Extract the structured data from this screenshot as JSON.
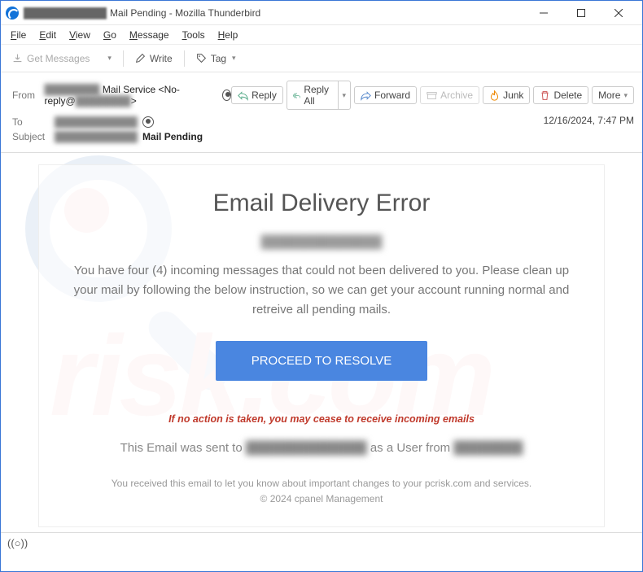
{
  "window": {
    "title_blurred": "████████████",
    "title_suffix": "Mail Pending - Mozilla Thunderbird"
  },
  "menu": {
    "file": "File",
    "edit": "Edit",
    "view": "View",
    "go": "Go",
    "message": "Message",
    "tools": "Tools",
    "help": "Help"
  },
  "toolbar": {
    "get_messages": "Get Messages",
    "write": "Write",
    "tag": "Tag"
  },
  "actions": {
    "reply": "Reply",
    "reply_all": "Reply All",
    "forward": "Forward",
    "archive": "Archive",
    "junk": "Junk",
    "delete": "Delete",
    "more": "More"
  },
  "headers": {
    "from_label": "From",
    "from_blur": "████████",
    "from_text": "Mail Service <No-reply@",
    "from_text2": "████████",
    "from_text3": ">",
    "to_label": "To",
    "to_blur": "████████████",
    "subject_label": "Subject",
    "subject_blur": "████████████",
    "subject_bold": "Mail Pending",
    "timestamp": "12/16/2024, 7:47 PM"
  },
  "email": {
    "heading": "Email Delivery Error",
    "recipient_blur": "██████████████",
    "paragraph": "You have four (4) incoming messages that could not been delivered to you. Please  clean up your mail  by following the below instruction, so we can get your account running normal and retreive all pending mails.",
    "cta": "PROCEED TO RESOLVE",
    "warning": "If no action is taken, you may cease to receive incoming emails",
    "sent_prefix": "This Email was sent to ",
    "sent_blur1": "██████████████",
    "sent_mid": " as a User from ",
    "sent_blur2": "████████",
    "footer1": "You received this email to let you know about important changes to your pcrisk.com and services.",
    "footer2": "© 2024 cpanel Management"
  },
  "status": {
    "signal": "((○))"
  }
}
